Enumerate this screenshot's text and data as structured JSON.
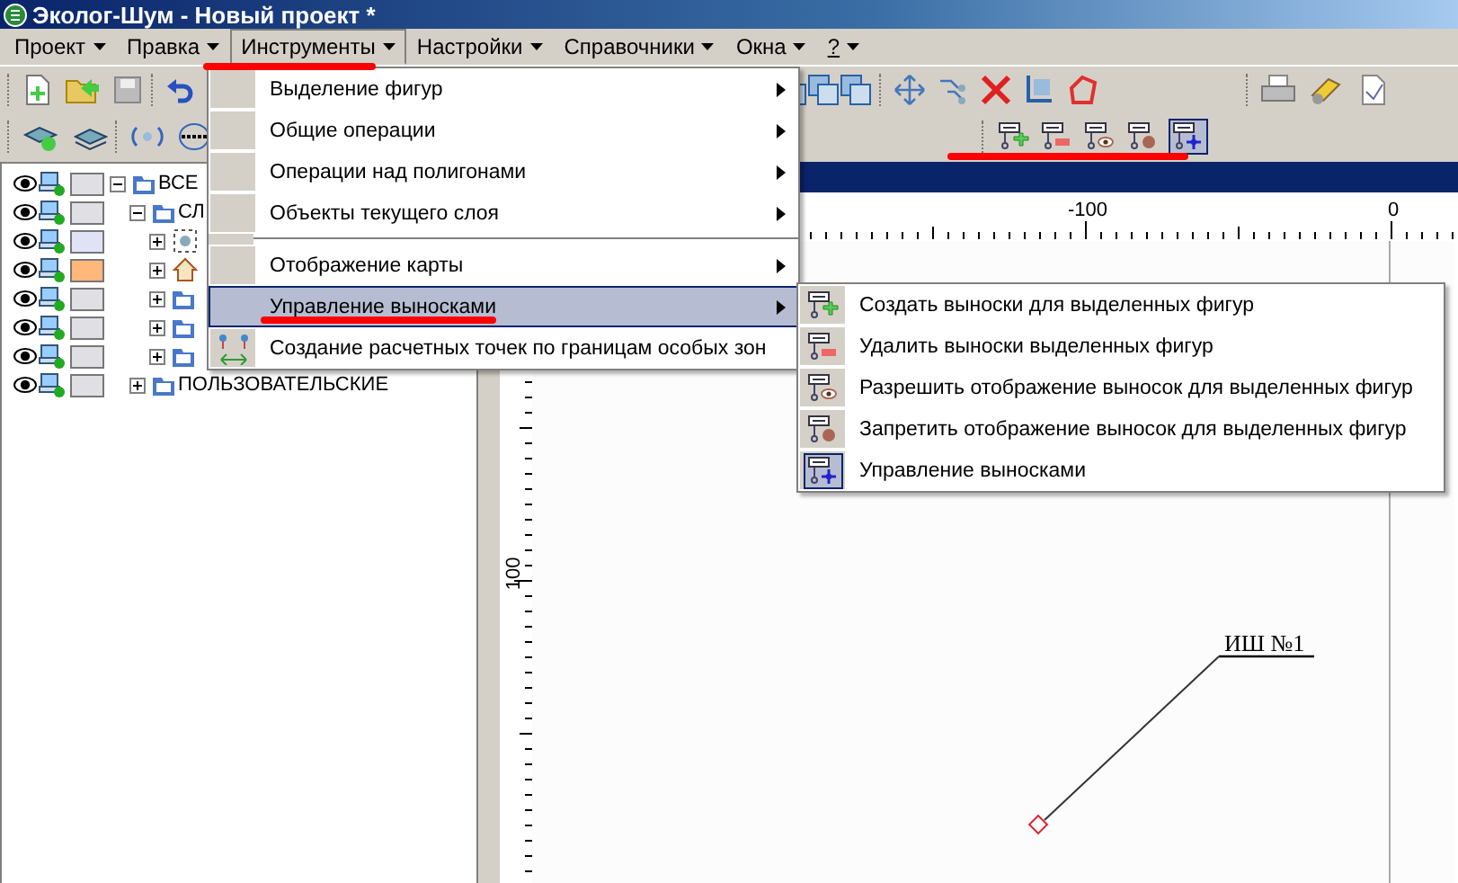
{
  "window": {
    "title": "Эколог-Шум - Новый проект *"
  },
  "menu_bar": [
    {
      "label": "Проект",
      "selected": false
    },
    {
      "label": "Правка",
      "selected": false
    },
    {
      "label": "Инструменты",
      "selected": true
    },
    {
      "label": "Настройки",
      "selected": false
    },
    {
      "label": "Справочники",
      "selected": false
    },
    {
      "label": "Окна",
      "selected": false
    },
    {
      "label": "?",
      "selected": false
    }
  ],
  "layers": [
    {
      "label": "ВСЕ",
      "kind": "folder",
      "expanded": true,
      "color": "#e0dfe3",
      "children": [
        {
          "label": "СЛ",
          "kind": "folder",
          "expanded": true,
          "color": "#e0dfe3",
          "children": [
            {
              "kind": "point",
              "expanded": false,
              "color": "#dfe3f5"
            },
            {
              "kind": "building",
              "expanded": false,
              "color": "#ffb77a"
            },
            {
              "kind": "folder",
              "expanded": false,
              "color": "#e0dfe3"
            },
            {
              "kind": "folder",
              "expanded": false,
              "color": "#e0dfe3"
            },
            {
              "kind": "folder",
              "expanded": false,
              "color": "#e0dfe3"
            }
          ]
        },
        {
          "label": "ПОЛЬЗОВАТЕЛЬСКИЕ",
          "kind": "folder",
          "expanded": false,
          "color": "#e0dfe3"
        }
      ]
    }
  ],
  "dropdown": [
    {
      "kind": "submenu",
      "label": "Выделение фигур",
      "selected": false
    },
    {
      "kind": "submenu",
      "label": "Общие операции",
      "selected": false
    },
    {
      "kind": "submenu",
      "label": "Операции над полигонами",
      "selected": false
    },
    {
      "kind": "submenu",
      "label": "Объекты текущего слоя",
      "selected": false
    },
    {
      "kind": "separator"
    },
    {
      "kind": "submenu",
      "label": "Отображение карты",
      "selected": false
    },
    {
      "kind": "submenu",
      "label": "Управление выносками",
      "selected": true
    },
    {
      "kind": "action",
      "label": "Создание расчетных точек по границам особых зон",
      "selected": false
    }
  ],
  "submenu": [
    {
      "kind": "add",
      "label": "Создать выноски для выделенных фигур",
      "checked": false
    },
    {
      "kind": "remove",
      "label": "Удалить выноски выделенных фигур",
      "checked": false
    },
    {
      "kind": "show",
      "label": "Разрешить отображение выносок для выделенных фигур",
      "checked": false
    },
    {
      "kind": "hide",
      "label": "Запретить отображение выносок для выделенных фигур",
      "checked": false
    },
    {
      "kind": "manage",
      "label": "Управление выносками",
      "checked": true
    }
  ],
  "ruler": {
    "x_labels": [
      "-100",
      "0"
    ],
    "y_labels": [
      "100"
    ]
  },
  "callout": {
    "label": "ИШ №1"
  }
}
